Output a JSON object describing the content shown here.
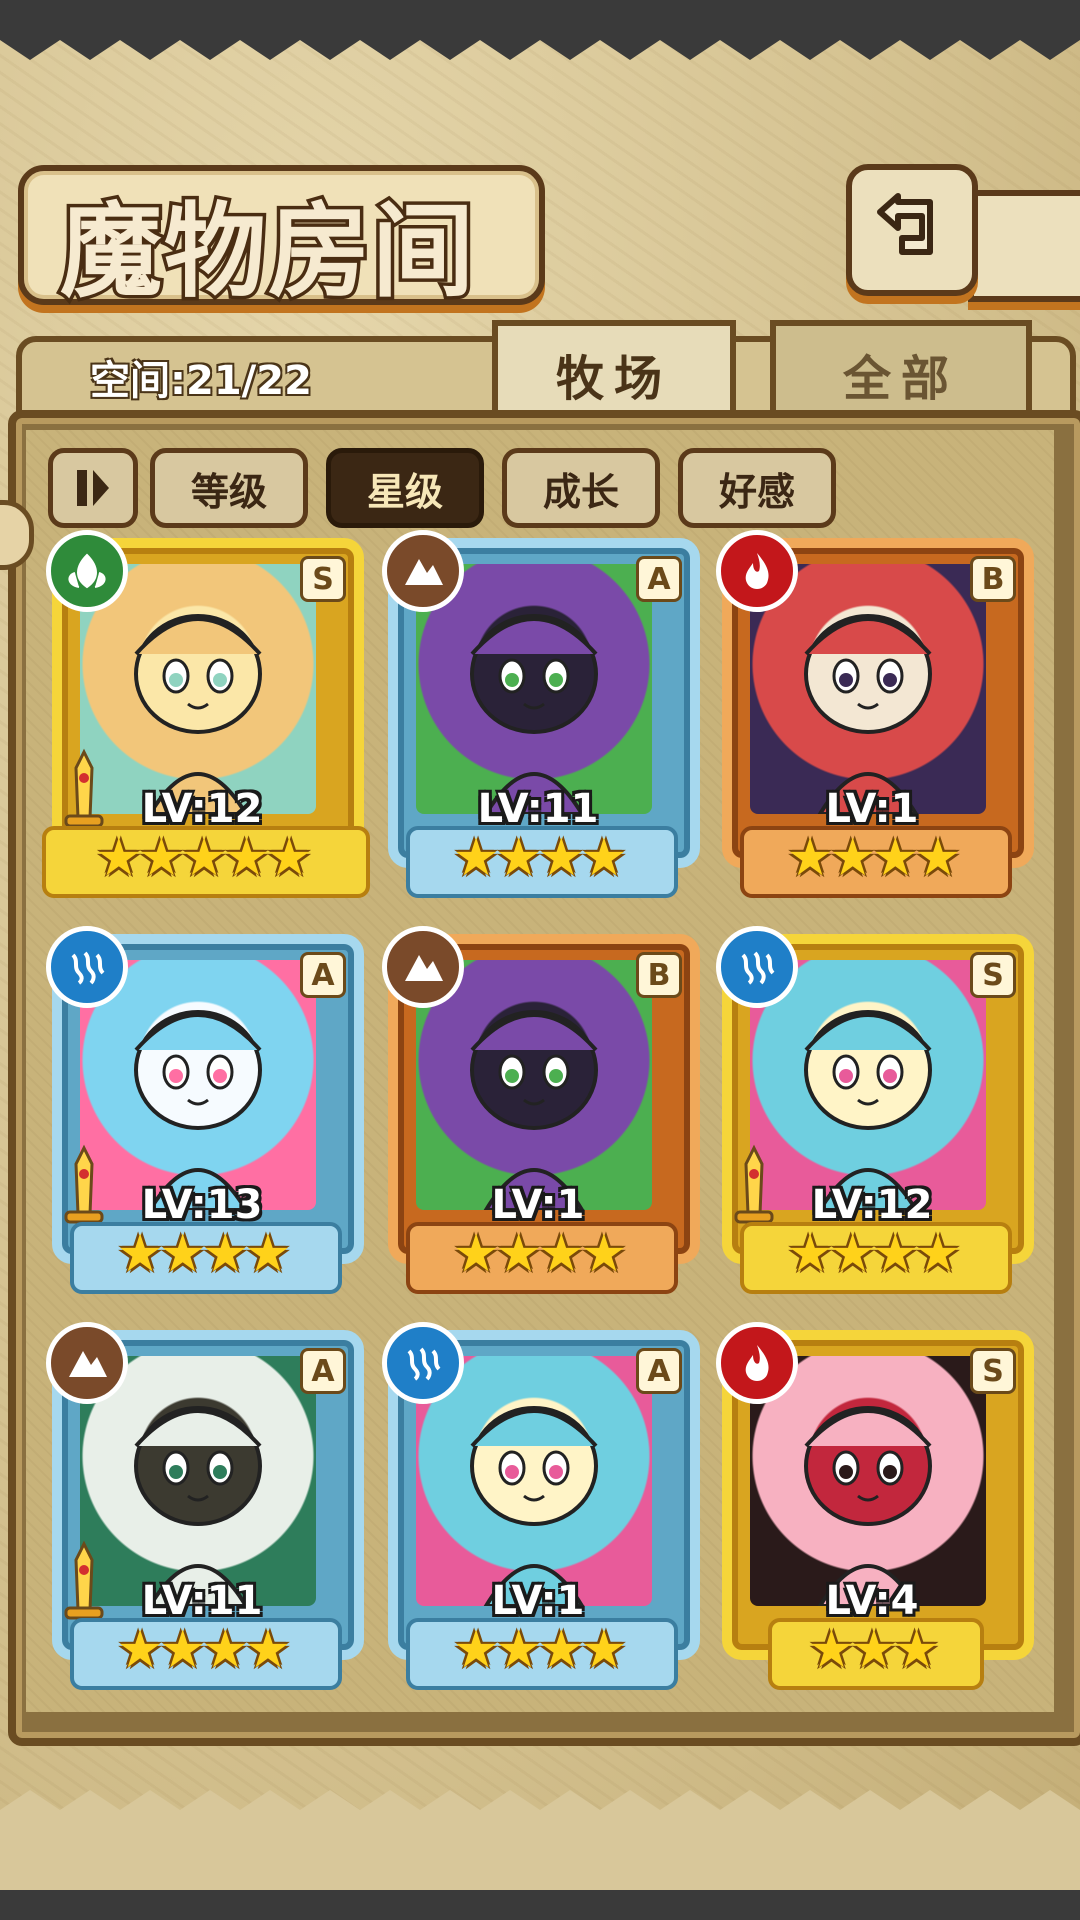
{
  "header": {
    "title": "魔物房间",
    "back_icon": "back-arrow-icon"
  },
  "storage": {
    "label": "空间:21/22"
  },
  "tabs": [
    {
      "label": "牧场",
      "active": true
    },
    {
      "label": "全部",
      "active": false
    }
  ],
  "sort": {
    "toggle_icon": "pause-toggle-icon",
    "buttons": [
      {
        "label": "等级",
        "active": false
      },
      {
        "label": "星级",
        "active": true
      },
      {
        "label": "成长",
        "active": false
      },
      {
        "label": "好感",
        "active": false
      }
    ]
  },
  "colors": {
    "gold_frame": "#f5d53a",
    "blue_frame": "#a6d8ee",
    "orange_frame": "#f0a95a",
    "fire": "#c3171b",
    "water": "#1f7fc8",
    "nature": "#2f8b3a",
    "earth": "#7a4a2a"
  },
  "monsters": [
    {
      "level": "LV:12",
      "rank": "S",
      "element": "nature",
      "frame": "gold",
      "stars": 5,
      "weapon": true,
      "art": "elf-girl"
    },
    {
      "level": "LV:11",
      "rank": "A",
      "element": "earth",
      "frame": "blue",
      "stars": 4,
      "weapon": false,
      "art": "purple-eye-demon"
    },
    {
      "level": "LV:1",
      "rank": "B",
      "element": "fire",
      "frame": "orange",
      "stars": 4,
      "weapon": false,
      "art": "fox-girl"
    },
    {
      "level": "LV:13",
      "rank": "A",
      "element": "water",
      "frame": "blue",
      "stars": 4,
      "weapon": true,
      "art": "swim-ring-girl"
    },
    {
      "level": "LV:1",
      "rank": "B",
      "element": "earth",
      "frame": "orange",
      "stars": 4,
      "weapon": false,
      "art": "purple-eye-demon"
    },
    {
      "level": "LV:12",
      "rank": "S",
      "element": "water",
      "frame": "gold",
      "stars": 4,
      "weapon": true,
      "art": "feather-chief"
    },
    {
      "level": "LV:11",
      "rank": "A",
      "element": "earth",
      "frame": "blue",
      "stars": 4,
      "weapon": true,
      "art": "white-hair-witch"
    },
    {
      "level": "LV:1",
      "rank": "A",
      "element": "water",
      "frame": "blue",
      "stars": 4,
      "weapon": false,
      "art": "feather-chief"
    },
    {
      "level": "LV:4",
      "rank": "S",
      "element": "fire",
      "frame": "gold",
      "stars": 3,
      "weapon": false,
      "art": "flower-girl"
    }
  ]
}
